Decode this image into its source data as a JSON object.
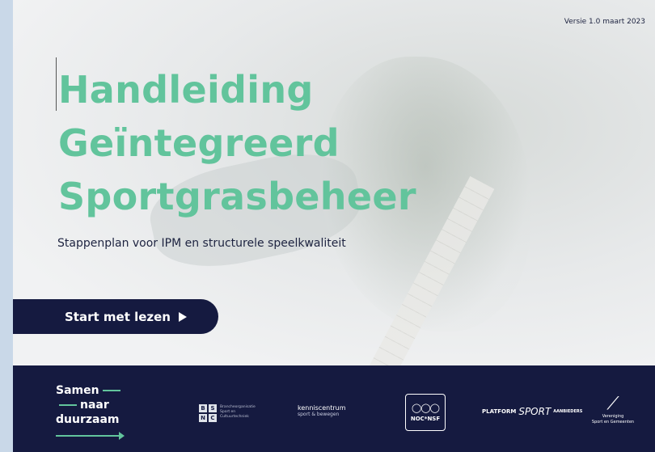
{
  "version": "Versie 1.0 maart 2023",
  "title": [
    "Handleiding",
    "Geïntegreerd",
    "Sportgrasbeheer"
  ],
  "subtitle": "Stappenplan voor IPM en structurele speelkwaliteit",
  "cta": {
    "label": "Start met lezen",
    "icon": "play-triangle-icon"
  },
  "brand": {
    "line1": "Samen",
    "line2": "naar",
    "line3": "duurzaam"
  },
  "partners": {
    "bsnc": {
      "letters": [
        "B",
        "S",
        "N",
        "C"
      ],
      "text": [
        "Brancheorganisatie",
        "Sport en",
        "Cultuurtechniek"
      ]
    },
    "kenniscentrum": {
      "name": "kenniscentrum",
      "sub": "sport & bewegen"
    },
    "noc": {
      "label": "NOC*NSF"
    },
    "platform": {
      "prefix": "PLATFORM",
      "name": "SPORT",
      "sub": "AANBIEDERS"
    },
    "vereniging": {
      "line1": "Vereniging",
      "line2": "Sport en Gemeenten"
    }
  },
  "colors": {
    "accent": "#62c49c",
    "navy": "#151a40",
    "background": "#eef0f1"
  }
}
